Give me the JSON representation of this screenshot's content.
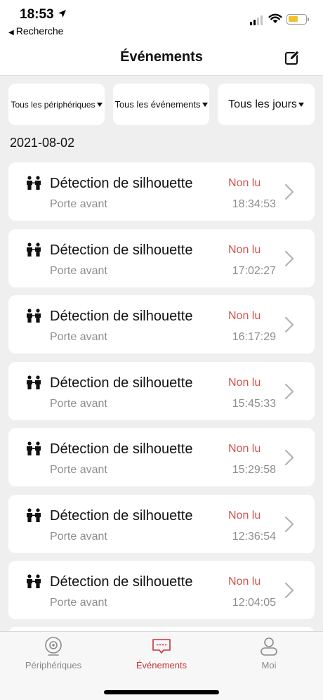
{
  "status_bar": {
    "time": "18:53",
    "back_label": "Recherche",
    "battery_color": "#f0c22c"
  },
  "header": {
    "title": "Événements",
    "edit_icon": "edit-icon"
  },
  "filters": {
    "devices": "Tous les périphériques",
    "events": "Tous les événements",
    "days": "Tous les jours"
  },
  "date_heading": "2021-08-02",
  "events": [
    {
      "title": "Détection de silhouette",
      "status": "Non lu",
      "device": "Porte avant",
      "time": "18:34:53"
    },
    {
      "title": "Détection de silhouette",
      "status": "Non lu",
      "device": "Porte avant",
      "time": "17:02:27"
    },
    {
      "title": "Détection de silhouette",
      "status": "Non lu",
      "device": "Porte avant",
      "time": "16:17:29"
    },
    {
      "title": "Détection de silhouette",
      "status": "Non lu",
      "device": "Porte avant",
      "time": "15:45:33"
    },
    {
      "title": "Détection de silhouette",
      "status": "Non lu",
      "device": "Porte avant",
      "time": "15:29:58"
    },
    {
      "title": "Détection de silhouette",
      "status": "Non lu",
      "device": "Porte avant",
      "time": "12:36:54"
    },
    {
      "title": "Détection de silhouette",
      "status": "Non lu",
      "device": "Porte avant",
      "time": "12:04:05"
    }
  ],
  "tabs": [
    {
      "label": "Périphériques",
      "icon": "camera-icon"
    },
    {
      "label": "Événements",
      "icon": "message-icon",
      "active": true
    },
    {
      "label": "Moi",
      "icon": "user-icon"
    }
  ],
  "colors": {
    "accent": "#c8333a",
    "unread": "#d0534c",
    "background": "#efefef"
  }
}
